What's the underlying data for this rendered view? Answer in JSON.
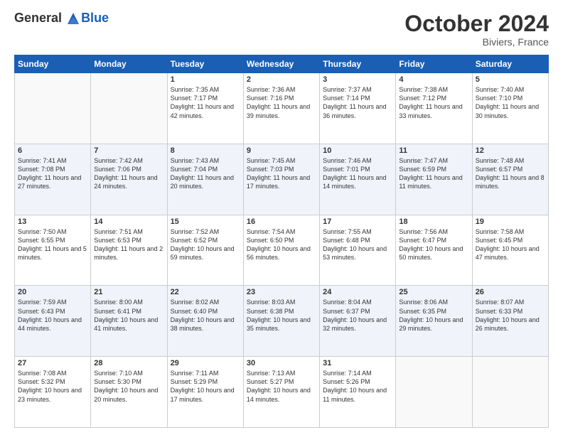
{
  "header": {
    "logo_line1": "General",
    "logo_line2": "Blue",
    "month_year": "October 2024",
    "location": "Biviers, France"
  },
  "weekdays": [
    "Sunday",
    "Monday",
    "Tuesday",
    "Wednesday",
    "Thursday",
    "Friday",
    "Saturday"
  ],
  "weeks": [
    [
      {
        "day": "",
        "info": ""
      },
      {
        "day": "",
        "info": ""
      },
      {
        "day": "1",
        "info": "Sunrise: 7:35 AM\nSunset: 7:17 PM\nDaylight: 11 hours and 42 minutes."
      },
      {
        "day": "2",
        "info": "Sunrise: 7:36 AM\nSunset: 7:16 PM\nDaylight: 11 hours and 39 minutes."
      },
      {
        "day": "3",
        "info": "Sunrise: 7:37 AM\nSunset: 7:14 PM\nDaylight: 11 hours and 36 minutes."
      },
      {
        "day": "4",
        "info": "Sunrise: 7:38 AM\nSunset: 7:12 PM\nDaylight: 11 hours and 33 minutes."
      },
      {
        "day": "5",
        "info": "Sunrise: 7:40 AM\nSunset: 7:10 PM\nDaylight: 11 hours and 30 minutes."
      }
    ],
    [
      {
        "day": "6",
        "info": "Sunrise: 7:41 AM\nSunset: 7:08 PM\nDaylight: 11 hours and 27 minutes."
      },
      {
        "day": "7",
        "info": "Sunrise: 7:42 AM\nSunset: 7:06 PM\nDaylight: 11 hours and 24 minutes."
      },
      {
        "day": "8",
        "info": "Sunrise: 7:43 AM\nSunset: 7:04 PM\nDaylight: 11 hours and 20 minutes."
      },
      {
        "day": "9",
        "info": "Sunrise: 7:45 AM\nSunset: 7:03 PM\nDaylight: 11 hours and 17 minutes."
      },
      {
        "day": "10",
        "info": "Sunrise: 7:46 AM\nSunset: 7:01 PM\nDaylight: 11 hours and 14 minutes."
      },
      {
        "day": "11",
        "info": "Sunrise: 7:47 AM\nSunset: 6:59 PM\nDaylight: 11 hours and 11 minutes."
      },
      {
        "day": "12",
        "info": "Sunrise: 7:48 AM\nSunset: 6:57 PM\nDaylight: 11 hours and 8 minutes."
      }
    ],
    [
      {
        "day": "13",
        "info": "Sunrise: 7:50 AM\nSunset: 6:55 PM\nDaylight: 11 hours and 5 minutes."
      },
      {
        "day": "14",
        "info": "Sunrise: 7:51 AM\nSunset: 6:53 PM\nDaylight: 11 hours and 2 minutes."
      },
      {
        "day": "15",
        "info": "Sunrise: 7:52 AM\nSunset: 6:52 PM\nDaylight: 10 hours and 59 minutes."
      },
      {
        "day": "16",
        "info": "Sunrise: 7:54 AM\nSunset: 6:50 PM\nDaylight: 10 hours and 56 minutes."
      },
      {
        "day": "17",
        "info": "Sunrise: 7:55 AM\nSunset: 6:48 PM\nDaylight: 10 hours and 53 minutes."
      },
      {
        "day": "18",
        "info": "Sunrise: 7:56 AM\nSunset: 6:47 PM\nDaylight: 10 hours and 50 minutes."
      },
      {
        "day": "19",
        "info": "Sunrise: 7:58 AM\nSunset: 6:45 PM\nDaylight: 10 hours and 47 minutes."
      }
    ],
    [
      {
        "day": "20",
        "info": "Sunrise: 7:59 AM\nSunset: 6:43 PM\nDaylight: 10 hours and 44 minutes."
      },
      {
        "day": "21",
        "info": "Sunrise: 8:00 AM\nSunset: 6:41 PM\nDaylight: 10 hours and 41 minutes."
      },
      {
        "day": "22",
        "info": "Sunrise: 8:02 AM\nSunset: 6:40 PM\nDaylight: 10 hours and 38 minutes."
      },
      {
        "day": "23",
        "info": "Sunrise: 8:03 AM\nSunset: 6:38 PM\nDaylight: 10 hours and 35 minutes."
      },
      {
        "day": "24",
        "info": "Sunrise: 8:04 AM\nSunset: 6:37 PM\nDaylight: 10 hours and 32 minutes."
      },
      {
        "day": "25",
        "info": "Sunrise: 8:06 AM\nSunset: 6:35 PM\nDaylight: 10 hours and 29 minutes."
      },
      {
        "day": "26",
        "info": "Sunrise: 8:07 AM\nSunset: 6:33 PM\nDaylight: 10 hours and 26 minutes."
      }
    ],
    [
      {
        "day": "27",
        "info": "Sunrise: 7:08 AM\nSunset: 5:32 PM\nDaylight: 10 hours and 23 minutes."
      },
      {
        "day": "28",
        "info": "Sunrise: 7:10 AM\nSunset: 5:30 PM\nDaylight: 10 hours and 20 minutes."
      },
      {
        "day": "29",
        "info": "Sunrise: 7:11 AM\nSunset: 5:29 PM\nDaylight: 10 hours and 17 minutes."
      },
      {
        "day": "30",
        "info": "Sunrise: 7:13 AM\nSunset: 5:27 PM\nDaylight: 10 hours and 14 minutes."
      },
      {
        "day": "31",
        "info": "Sunrise: 7:14 AM\nSunset: 5:26 PM\nDaylight: 10 hours and 11 minutes."
      },
      {
        "day": "",
        "info": ""
      },
      {
        "day": "",
        "info": ""
      }
    ]
  ]
}
